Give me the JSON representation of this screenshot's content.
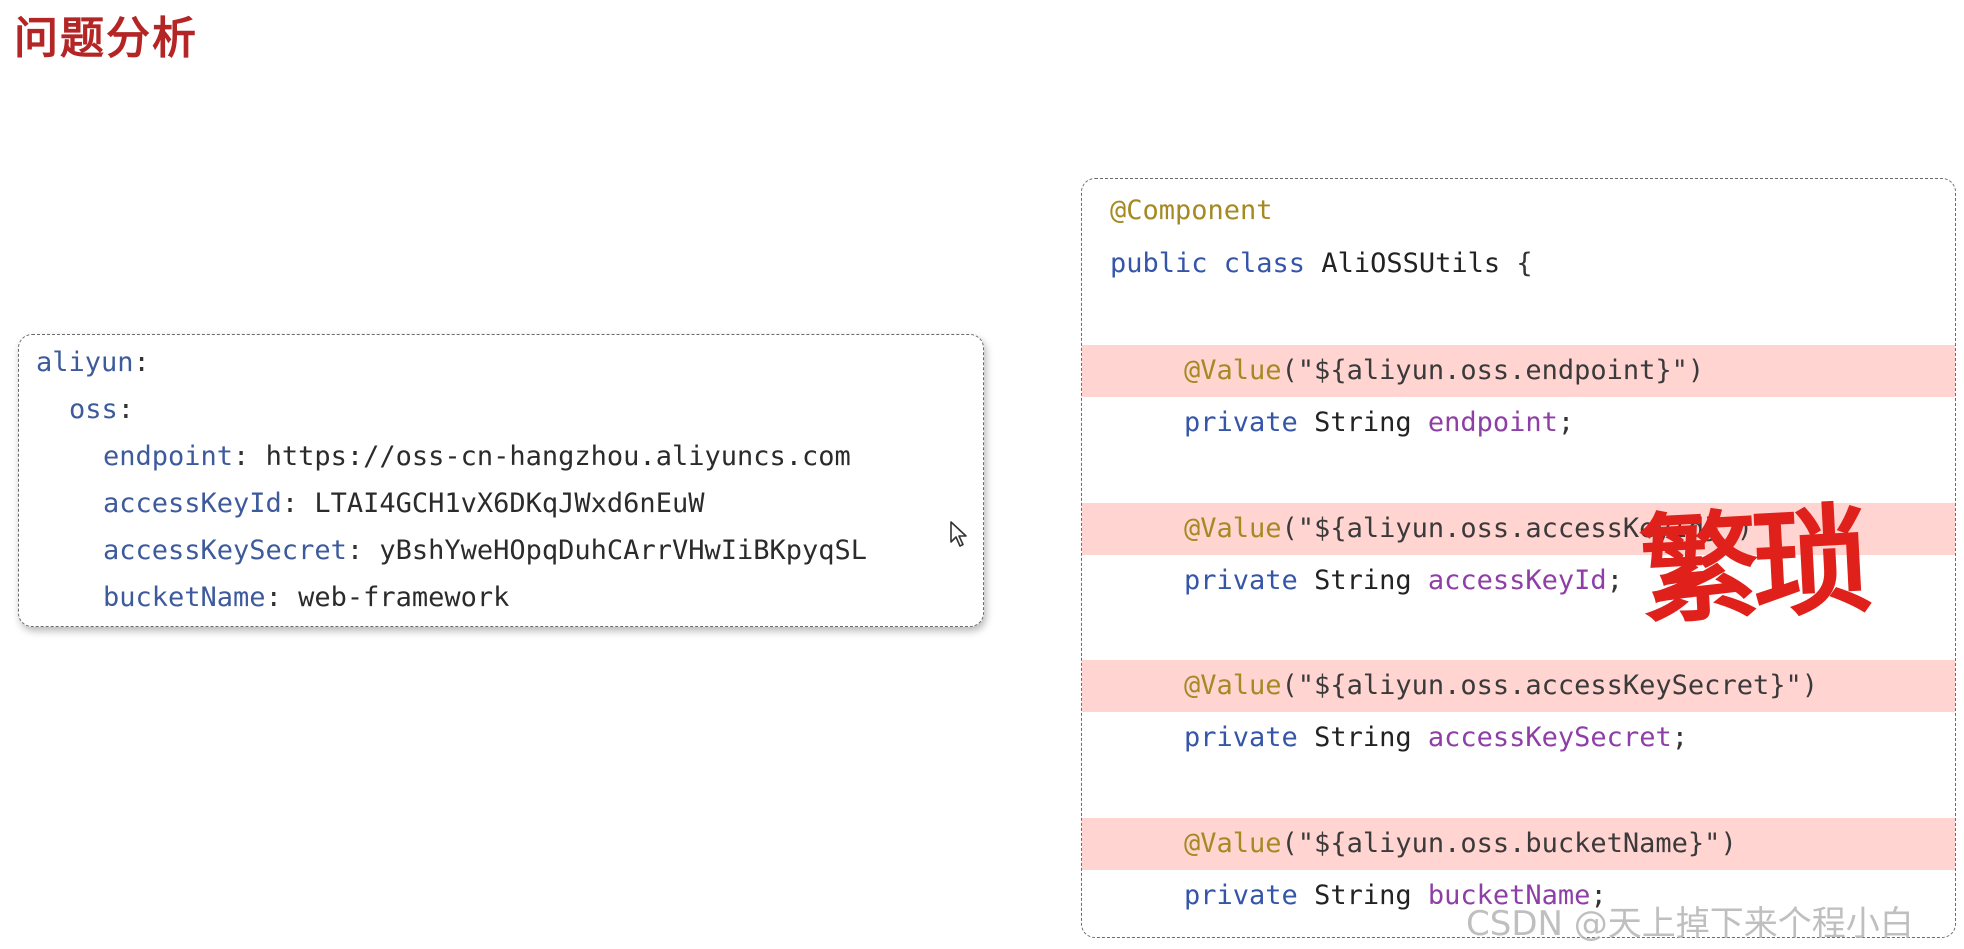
{
  "title": "问题分析",
  "yaml_lines": [
    {
      "key": "aliyun",
      "sep": ":",
      "value": ""
    },
    {
      "key": "oss",
      "sep": ":",
      "value": ""
    },
    {
      "key": "endpoint",
      "sep": ": ",
      "value": "https://oss-cn-hangzhou.aliyuncs.com"
    },
    {
      "key": "accessKeyId",
      "sep": ": ",
      "value": "LTAI4GCH1vX6DKqJWxd6nEuW"
    },
    {
      "key": "accessKeySecret",
      "sep": ": ",
      "value": "yBshYweHOpqDuhCArrVHwIiBKpyqSL"
    },
    {
      "key": "bucketName",
      "sep": ": ",
      "value": "web-framework"
    }
  ],
  "java": {
    "class_annotation": "@Component",
    "class_decl": {
      "kw": "public class",
      "name": "AliOSSUtils",
      "brace": "{"
    },
    "fields": [
      {
        "annotation": "@Value",
        "arg": "(\"${aliyun.oss.endpoint}\")",
        "modifier": "private",
        "type": "String",
        "name": "endpoint",
        "end": ";"
      },
      {
        "annotation": "@Value",
        "arg": "(\"${aliyun.oss.accessKeyId}\")",
        "modifier": "private",
        "type": "String",
        "name": "accessKeyId",
        "end": ";"
      },
      {
        "annotation": "@Value",
        "arg": "(\"${aliyun.oss.accessKeySecret}\")",
        "modifier": "private",
        "type": "String",
        "name": "accessKeySecret",
        "end": ";"
      },
      {
        "annotation": "@Value",
        "arg": "(\"${aliyun.oss.bucketName}\")",
        "modifier": "private",
        "type": "String",
        "name": "bucketName",
        "end": ";"
      }
    ]
  },
  "stamp_text": "繁琐",
  "watermark": "CSDN @天上掉下来个程小白",
  "colors": {
    "title": "#b42525",
    "highlight": "#ffd4d1",
    "stamp": "#e0201b"
  }
}
